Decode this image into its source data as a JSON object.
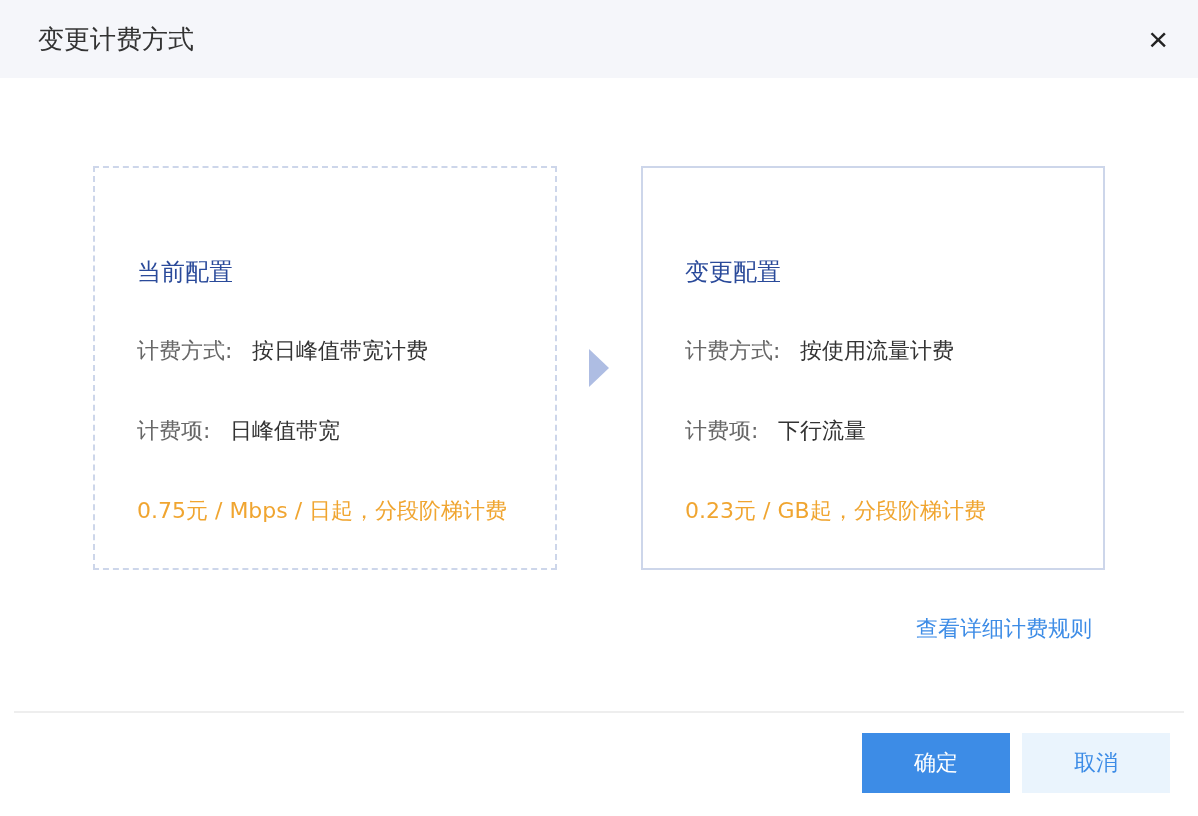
{
  "dialog": {
    "title": "变更计费方式",
    "close": "×"
  },
  "cards": [
    {
      "kind": "current",
      "heading": "当前配置",
      "rows": [
        {
          "label": "计费方式:",
          "value": "按日峰值带宽计费"
        },
        {
          "label": "计费项:",
          "value": "日峰值带宽"
        }
      ],
      "price": "0.75元 / Mbps / 日起，分段阶梯计费"
    },
    {
      "kind": "target",
      "heading": "变更配置",
      "rows": [
        {
          "label": "计费方式:",
          "value": "按使用流量计费"
        },
        {
          "label": "计费项:",
          "value": "下行流量"
        }
      ],
      "price": "0.23元 / GB起，分段阶梯计费"
    }
  ],
  "link": "查看详细计费规则",
  "buttons": [
    {
      "label": "确定",
      "kind": "primary"
    },
    {
      "label": "取消",
      "kind": "secondary"
    }
  ]
}
